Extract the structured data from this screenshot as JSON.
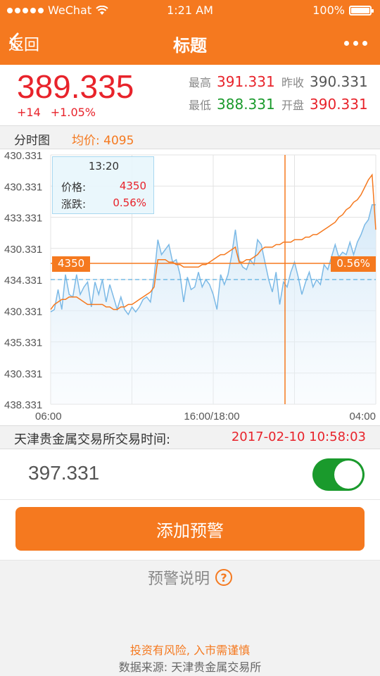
{
  "status_bar": {
    "carrier": "WeChat",
    "time": "1:21 AM",
    "battery": "100%"
  },
  "nav": {
    "back_label": "返回",
    "title": "标题"
  },
  "quote": {
    "price": "389.335",
    "change": "+14",
    "change_pct": "+1.05%",
    "high_label": "最高",
    "high": "391.331",
    "prev_close_label": "昨收",
    "prev_close": "390.331",
    "low_label": "最低",
    "low": "388.331",
    "open_label": "开盘",
    "open": "390.331"
  },
  "info": {
    "chart_label": "分时图",
    "avg_label": "均价:",
    "avg_value": "4095"
  },
  "tooltip": {
    "time": "13:20",
    "price_label": "价格:",
    "price": "4350",
    "change_label": "涨跌:",
    "change": "0.56%"
  },
  "crosshair": {
    "left_tag": "4350",
    "right_tag": "0.56%"
  },
  "chart_data": {
    "type": "line",
    "y_tick_labels": [
      "430.331",
      "430.331",
      "433.331",
      "430.331",
      "434.331",
      "430.331",
      "435.331",
      "430.331",
      "438.331"
    ],
    "x_tick_labels": [
      "06:00",
      "16:00/18:00",
      "04:00"
    ],
    "series": [
      {
        "color": "#f5791f",
        "values": [
          0.62,
          0.6,
          0.59,
          0.58,
          0.58,
          0.57,
          0.57,
          0.57,
          0.58,
          0.59,
          0.6,
          0.6,
          0.6,
          0.6,
          0.6,
          0.61,
          0.61,
          0.62,
          0.62,
          0.61,
          0.61,
          0.6,
          0.6,
          0.59,
          0.58,
          0.57,
          0.56,
          0.55,
          0.53,
          0.42,
          0.42,
          0.42,
          0.43,
          0.43,
          0.44,
          0.44,
          0.45,
          0.45,
          0.45,
          0.45,
          0.45,
          0.44,
          0.44,
          0.43,
          0.42,
          0.41,
          0.4,
          0.4,
          0.39,
          0.38,
          0.37,
          0.43,
          0.43,
          0.42,
          0.42,
          0.41,
          0.4,
          0.38,
          0.37,
          0.37,
          0.37,
          0.36,
          0.36,
          0.35,
          0.35,
          0.35,
          0.34,
          0.34,
          0.34,
          0.33,
          0.33,
          0.32,
          0.32,
          0.31,
          0.3,
          0.29,
          0.28,
          0.27,
          0.25,
          0.24,
          0.22,
          0.21,
          0.19,
          0.18,
          0.16,
          0.13,
          0.1,
          0.08,
          0.3
        ]
      },
      {
        "color": "#7bb9e6",
        "values": [
          0.63,
          0.62,
          0.54,
          0.62,
          0.48,
          0.56,
          0.57,
          0.48,
          0.56,
          0.53,
          0.51,
          0.61,
          0.51,
          0.56,
          0.5,
          0.59,
          0.52,
          0.57,
          0.62,
          0.57,
          0.62,
          0.64,
          0.61,
          0.63,
          0.61,
          0.58,
          0.57,
          0.59,
          0.49,
          0.34,
          0.4,
          0.38,
          0.36,
          0.43,
          0.42,
          0.48,
          0.59,
          0.49,
          0.54,
          0.53,
          0.47,
          0.53,
          0.5,
          0.52,
          0.56,
          0.62,
          0.48,
          0.52,
          0.48,
          0.4,
          0.3,
          0.42,
          0.45,
          0.46,
          0.42,
          0.44,
          0.34,
          0.36,
          0.43,
          0.5,
          0.55,
          0.47,
          0.6,
          0.51,
          0.53,
          0.47,
          0.43,
          0.49,
          0.56,
          0.51,
          0.47,
          0.53,
          0.5,
          0.52,
          0.44,
          0.46,
          0.41,
          0.36,
          0.41,
          0.39,
          0.4,
          0.35,
          0.4,
          0.35,
          0.32,
          0.28,
          0.26,
          0.2,
          0.2
        ]
      }
    ]
  },
  "trade_time": {
    "label": "天津贵金属交易所交易时间:",
    "value": "2017-02-10  10:58:03"
  },
  "alert": {
    "value": "397.331",
    "button_label": "添加预警",
    "explain_label": "预警说明"
  },
  "footer": {
    "risk": "投资有风险, 入市需谨慎",
    "source": "数据来源: 天津贵金属交易所"
  }
}
